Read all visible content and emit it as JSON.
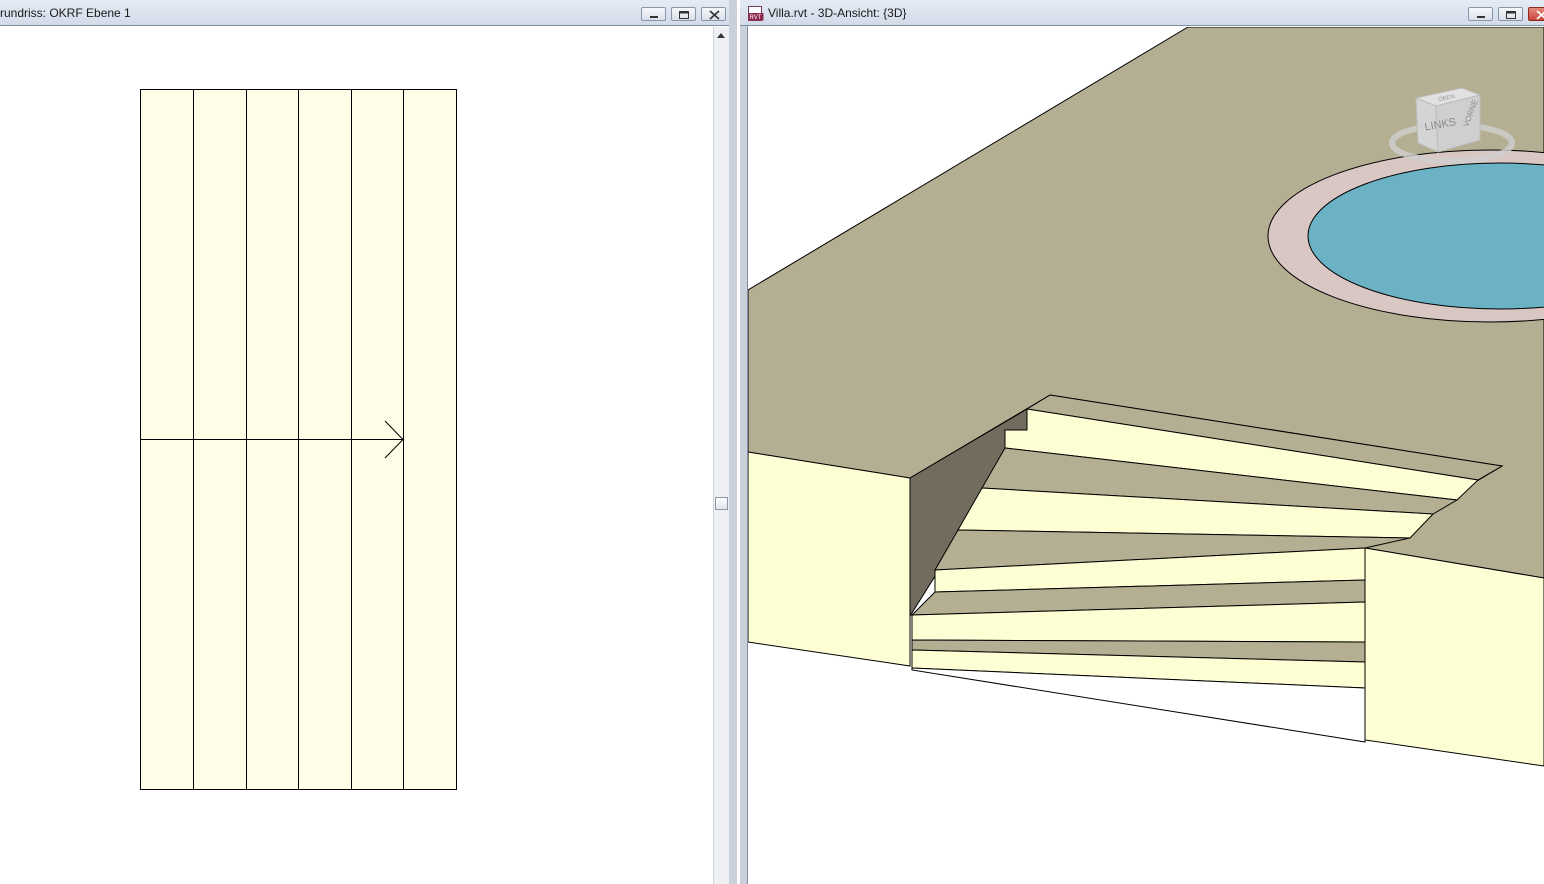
{
  "left_window": {
    "title": "rundriss: OKRF Ebene 1",
    "controls": [
      "minimize",
      "restore",
      "close"
    ]
  },
  "right_window": {
    "title": "Villa.rvt - 3D-Ansicht: {3D}",
    "app_icon": "revit-rvt-icon",
    "app_icon_text": "RVT",
    "controls": [
      "minimize",
      "restore",
      "close"
    ]
  },
  "viewcube": {
    "front_face_label": "LINKS",
    "side_face_label": "VORNE",
    "top_face_label": "OBEN"
  },
  "colors": {
    "stair_fill": "#fefee8",
    "floor_surface": "#b4ae92",
    "wall_cream": "#fefed5",
    "wall_shadow": "#716c5d",
    "pool_water": "#6bb2c4",
    "pool_rim": "#d9c7c4",
    "close_button_red": "#c9443a"
  }
}
